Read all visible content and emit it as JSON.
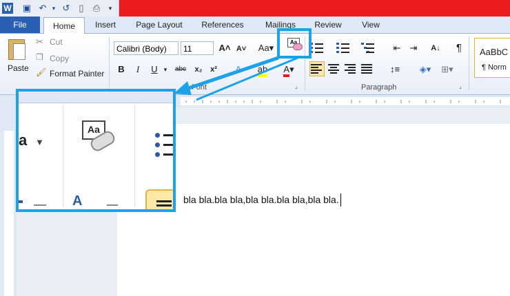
{
  "app": {
    "icon": "word-icon"
  },
  "quick_access": [
    "save-icon",
    "undo-icon",
    "redo-icon",
    "new-doc-icon",
    "print-preview-icon",
    "customize-icon"
  ],
  "tabs": [
    {
      "label": "File"
    },
    {
      "label": "Home"
    },
    {
      "label": "Insert"
    },
    {
      "label": "Page Layout"
    },
    {
      "label": "References"
    },
    {
      "label": "Mailings"
    },
    {
      "label": "Review"
    },
    {
      "label": "View"
    }
  ],
  "clipboard": {
    "paste": "Paste",
    "cut": "Cut",
    "copy": "Copy",
    "format_painter": "Format Painter"
  },
  "font": {
    "name": "Calibri (Body)",
    "size": "11",
    "group_label": "Font"
  },
  "paragraph": {
    "group_label": "Paragraph"
  },
  "styles": {
    "preview": "AaBbC",
    "normal": "¶ Norm"
  },
  "document": {
    "text": "bla bla.bla bla,bla bla.bla bla,bla bla."
  },
  "callout": {
    "icon": "clear-formatting-icon",
    "color": "#1da1e8"
  }
}
